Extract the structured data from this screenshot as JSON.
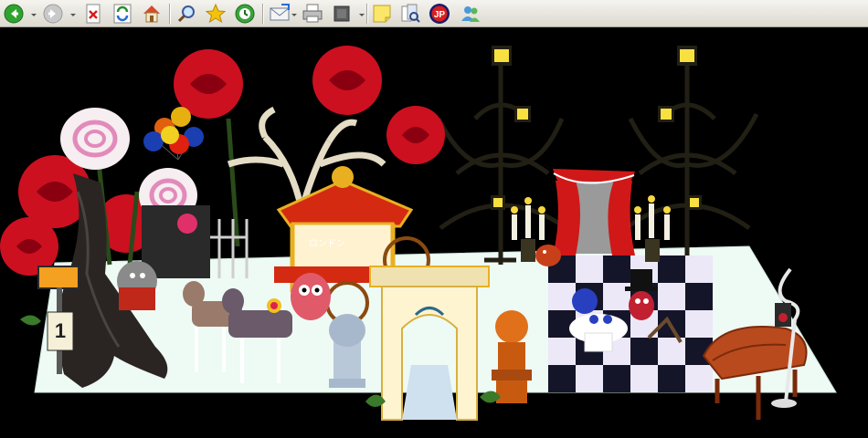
{
  "toolbar": {
    "buttons": [
      {
        "name": "back",
        "icon": "back-arrow-icon"
      },
      {
        "name": "forward",
        "icon": "forward-arrow-icon"
      },
      {
        "name": "stop",
        "icon": "stop-icon"
      },
      {
        "name": "refresh",
        "icon": "refresh-icon"
      },
      {
        "name": "home",
        "icon": "home-icon"
      },
      {
        "name": "search",
        "icon": "search-icon"
      },
      {
        "name": "favorites",
        "icon": "star-icon"
      },
      {
        "name": "history",
        "icon": "history-icon"
      },
      {
        "name": "mail",
        "icon": "mail-icon"
      },
      {
        "name": "print",
        "icon": "printer-icon"
      },
      {
        "name": "edit",
        "icon": "edit-page-icon"
      },
      {
        "name": "note",
        "icon": "sticky-note-icon"
      },
      {
        "name": "research",
        "icon": "research-icon"
      },
      {
        "name": "addon",
        "icon": "jp-addon-icon"
      },
      {
        "name": "messenger",
        "icon": "messenger-icon"
      }
    ],
    "addon_badge": "JP"
  },
  "scene": {
    "colors": {
      "floor": "#eefaf4",
      "rose_red": "#cc1020",
      "rose_white": "#f6eef0",
      "carriage_red": "#d42a12",
      "gold": "#e8b020",
      "curtain": "#d01818",
      "checker_dark": "#15152a",
      "checker_light": "#ece8f8",
      "piano": "#b84a1e",
      "lamp_glow": "#f8e040"
    },
    "sign_number": "1",
    "carriage_label": "ロンドン"
  }
}
